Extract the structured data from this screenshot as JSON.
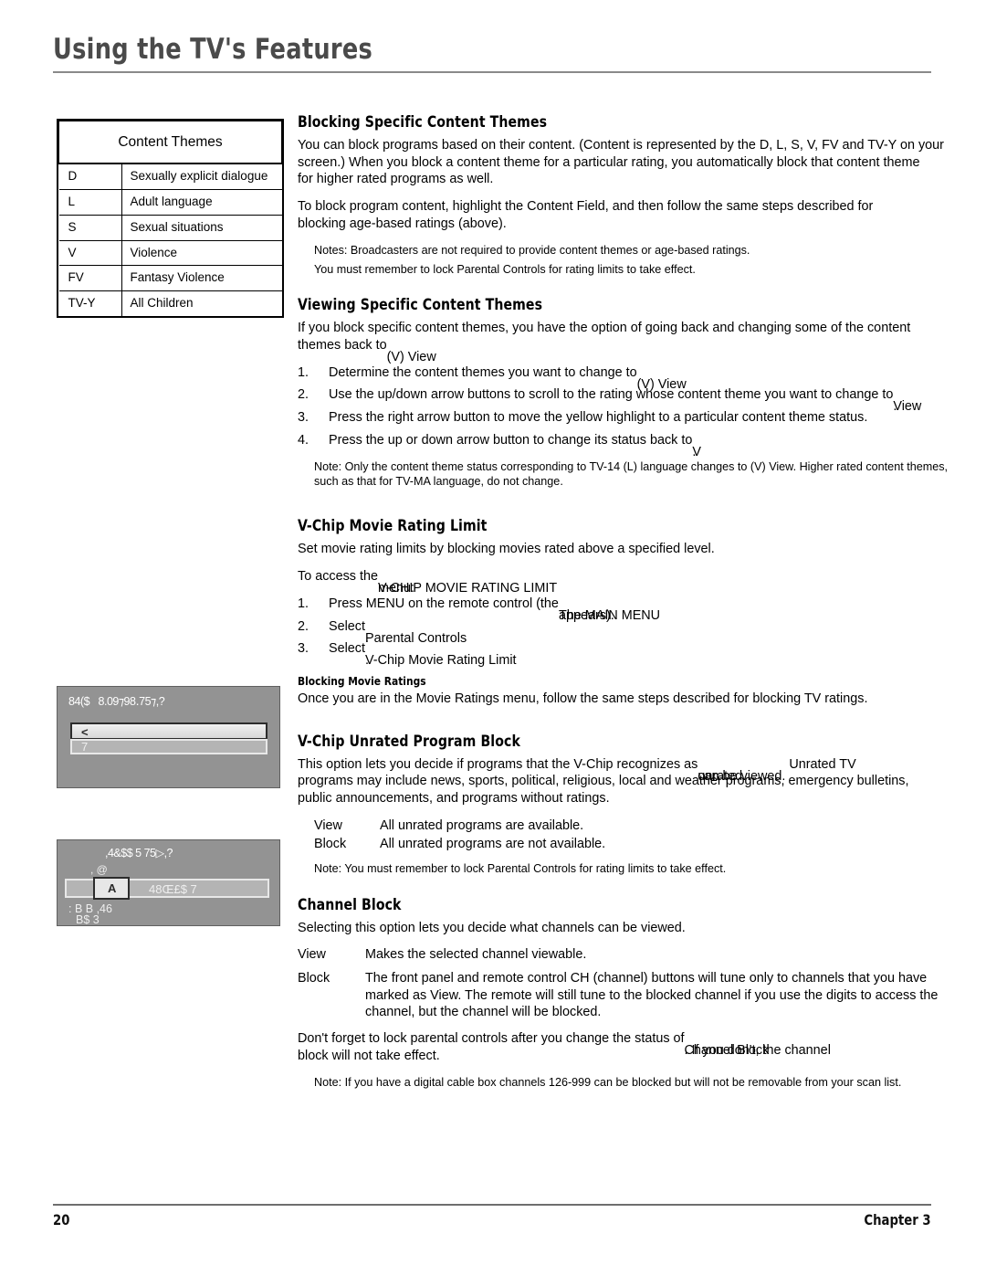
{
  "header": {
    "title": "Using the TV's Features"
  },
  "themes_table": {
    "caption": "Content Themes",
    "rows": [
      {
        "code": "D",
        "desc": "Sexually explicit dialogue"
      },
      {
        "code": "L",
        "desc": "Adult language"
      },
      {
        "code": "S",
        "desc": "Sexual situations"
      },
      {
        "code": "V",
        "desc": "Violence"
      },
      {
        "code": "FV",
        "desc": "Fantasy Violence"
      },
      {
        "code": "TV-Y",
        "desc": "All Children"
      }
    ]
  },
  "sections": {
    "blocking_content": {
      "heading": "Blocking Specific Content Themes",
      "p1_line1": "You can block programs based on their content. (Content is represented by the D, L, S, V, FV and TV-Y on your",
      "p1_line2": "screen.) When you block a content theme for a particular rating, you automatically block that content theme",
      "p1_line3": "for higher rated programs as well.",
      "p2_line1": "To block program content,  highlight the Content Field, and then follow the same steps described for",
      "p2_line2": "blocking age-based ratings (above).",
      "note1": "Notes:  Broadcasters are not required to provide content themes or age-based ratings.",
      "note2": "You must remember to lock Parental Controls for rating limits to take effect."
    },
    "viewing_content": {
      "heading": "Viewing Specific Content Themes",
      "p1_line1": "If you block specific content themes, you have the option of going back and changing some of the content",
      "p1_line2_a": "themes back to",
      "p1_line2_overlap_a": "(V) View",
      "p1_line2_overlap_b": ".",
      "steps": [
        {
          "num": "1.",
          "text": "Determine the content themes you want to change to",
          "overlap_a": "(V) View",
          "overlap_b": "."
        },
        {
          "num": "2.",
          "text": "Use the up/down arrow buttons to scroll to the rating whose content theme you want to change to",
          "overlap_a": "View",
          "overlap_b": "."
        },
        {
          "num": "3.",
          "text": "Press the right arrow button to move the yellow highlight to a particular content theme status.",
          "overlap_a": "",
          "overlap_b": ""
        },
        {
          "num": "4.",
          "text": "Press the up or down arrow button to change its status back to",
          "overlap_a": "V",
          "overlap_b": "."
        }
      ],
      "note_line1": "Note:  Only the content theme status corresponding to TV-14 (L) language changes to (V) View. Higher rated content themes,",
      "note_line2": "such as that for TV-MA language, do not change."
    },
    "movie_rating_limit": {
      "heading": "V-Chip Movie Rating Limit",
      "p1": "Set movie rating limits by blocking movies rated above a specified level.",
      "p2_a": "To access the",
      "p2_overlap_a": "V-CHIP MOVIE RATING LIMIT",
      "p2_overlap_b": " menu:",
      "steps": [
        {
          "num": "1.",
          "text": "Press MENU on the remote control (the",
          "overlap_a": "The MAIN MENU",
          "overlap_b": " appears)."
        },
        {
          "num": "2.",
          "text": "Select",
          "overlap_a": "Parental Controls",
          "overlap_b": "."
        },
        {
          "num": "3.",
          "text": "Select",
          "overlap_a": "V-Chip Movie Rating Limit",
          "overlap_b": "."
        }
      ],
      "subheading": "Blocking Movie Ratings",
      "p3": "Once you are in the Movie Ratings menu, follow the same steps described for blocking TV ratings."
    },
    "unrated_program_block": {
      "heading": "V-Chip Unrated Program Block",
      "p1_line1_a": "This option lets you decide if programs that the V-Chip recognizes as",
      "p1_line1_overlap_a": "unrated",
      "p1_line1_b": " can be viewed.",
      "p1_line1_overlap_b": "Unrated TV",
      "p1_line2": "programs may include news, sports, political, religious, local and weather programs, emergency bulletins,",
      "p1_line3": "public announcements, and programs without ratings.",
      "defs": [
        {
          "term": "View",
          "text": "All unrated programs are available."
        },
        {
          "term": "Block",
          "text": "All unrated programs are not available."
        }
      ],
      "note": "Note: You must remember to lock Parental Controls for rating limits to take effect."
    },
    "channel_block": {
      "heading": "Channel Block",
      "p1": "Selecting this option lets you decide what channels can be viewed.",
      "defs": [
        {
          "term": "View",
          "lines": [
            "Makes the selected channel viewable."
          ]
        },
        {
          "term": "Block",
          "lines": [
            "The front panel and remote control CH (channel) buttons will tune only to channels that you have",
            "marked as View. The remote will still tune to the blocked channel if you use the digits to access the",
            "channel, but the channel will be blocked."
          ]
        }
      ],
      "p2_line1_a": "Don't forget to lock parental controls after you change the status of",
      "p2_line1_overlap": "Channel Block",
      "p2_line1_b": ". If you don't, the channel",
      "p2_line2": "block will not take effect.",
      "note": "Note: If you have a digital cable box channels 126-999 can be blocked but will not be removable from your scan list."
    }
  },
  "screenshots": {
    "unrated": {
      "title": "84($8.09⁊98․75⁊,?",
      "row1": "<",
      "row2": "7"
    },
    "channel": {
      "title": ",4&$$ 5 75▷,?",
      "label_small": ", @",
      "cell_value": "A",
      "bar_text": "48Œ£$      7",
      "footer_line1": ": B  B ,46",
      "footer_line2": "B$ 3"
    }
  },
  "footer": {
    "page_number": "20",
    "chapter": "Chapter  3"
  }
}
